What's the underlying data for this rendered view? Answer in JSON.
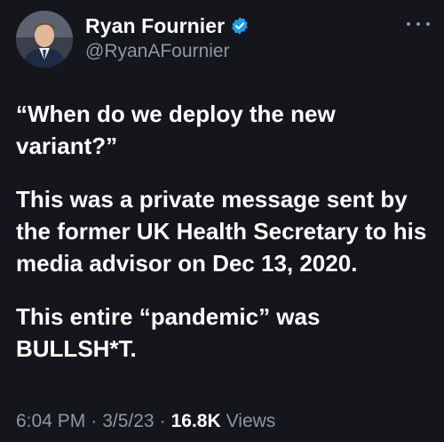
{
  "tweet": {
    "author": {
      "display_name": "Ryan Fournier",
      "handle": "@RyanAFournier",
      "verified": true,
      "verified_color": "#1d9bf0"
    },
    "paragraphs": [
      "“When do we deploy the new variant?”",
      "This was a private message sent by the former UK Health Secretary to his media advisor on Dec 13, 2020.",
      "This entire “pandemic” was BULLSH*T."
    ],
    "meta": {
      "time": "6:04 PM",
      "separator": "·",
      "date": "3/5/23",
      "views_count": "16.8K",
      "views_label": "Views"
    },
    "icons": {
      "more": "more-horizontal-icon",
      "verified": "verified-badge-icon"
    }
  }
}
